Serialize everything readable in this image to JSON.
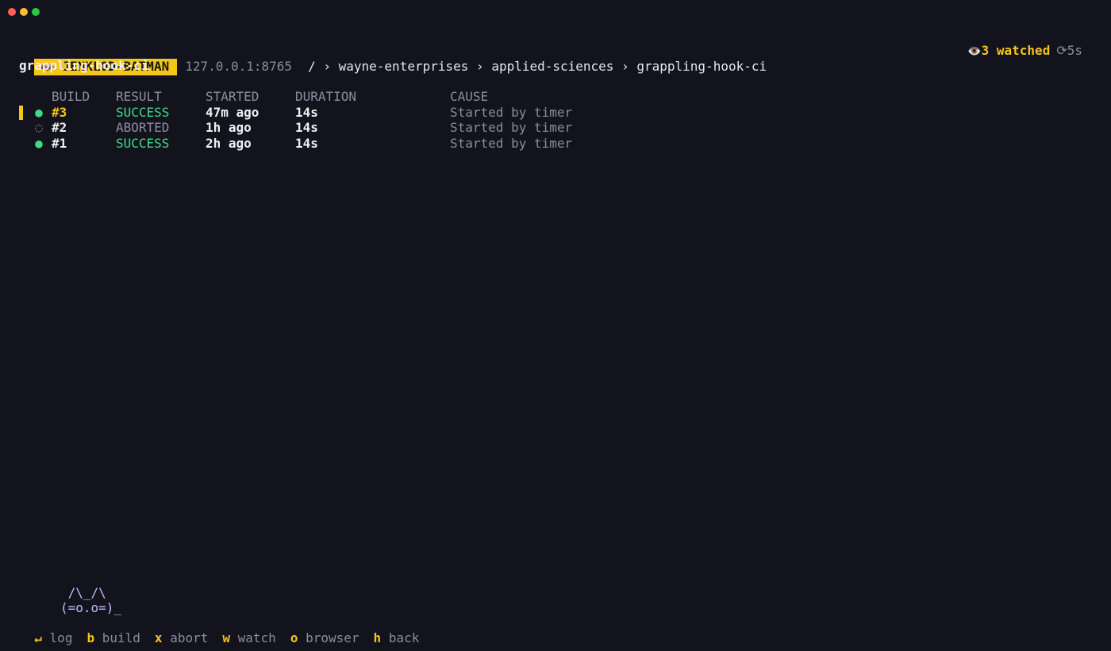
{
  "app": {
    "name": "JENKLOD-BATMAN",
    "icon": "bat-icon",
    "host": "127.0.0.1:8765"
  },
  "breadcrumb": [
    "/",
    "wayne-enterprises",
    "applied-sciences",
    "grappling-hook-ci"
  ],
  "breadcrumb_separator": "›",
  "watch": {
    "icon": "eye-icon",
    "label": "3 watched",
    "refresh": "⟳5s"
  },
  "job": {
    "title": "grappling-hook-ci"
  },
  "table": {
    "headers": {
      "build": "BUILD",
      "result": "RESULT",
      "started": "STARTED",
      "duration": "DURATION",
      "cause": "CAUSE"
    },
    "rows": [
      {
        "dot": "●",
        "build": "#3",
        "result": "SUCCESS",
        "started": "47m ago",
        "duration": "14s",
        "cause": "Started by timer",
        "selected": true,
        "status": "success"
      },
      {
        "dot": "◌",
        "build": "#2",
        "result": "ABORTED",
        "started": "1h ago",
        "duration": "14s",
        "cause": "Started by timer",
        "selected": false,
        "status": "aborted"
      },
      {
        "dot": "●",
        "build": "#1",
        "result": "SUCCESS",
        "started": "2h ago",
        "duration": "14s",
        "cause": "Started by timer",
        "selected": false,
        "status": "success"
      }
    ]
  },
  "mascot": {
    "line1": " /\\_/\\",
    "line2": "(=o.o=)_"
  },
  "keys": [
    {
      "key": "↵",
      "label": "log"
    },
    {
      "key": "b",
      "label": "build"
    },
    {
      "key": "x",
      "label": "abort"
    },
    {
      "key": "w",
      "label": "watch"
    },
    {
      "key": "o",
      "label": "browser"
    },
    {
      "key": "h",
      "label": "back"
    }
  ],
  "colors": {
    "accent": "#f5c518",
    "success": "#3ddc84",
    "muted": "#8b8d9e",
    "background": "#12131d",
    "mascot": "#c8b9ff"
  }
}
